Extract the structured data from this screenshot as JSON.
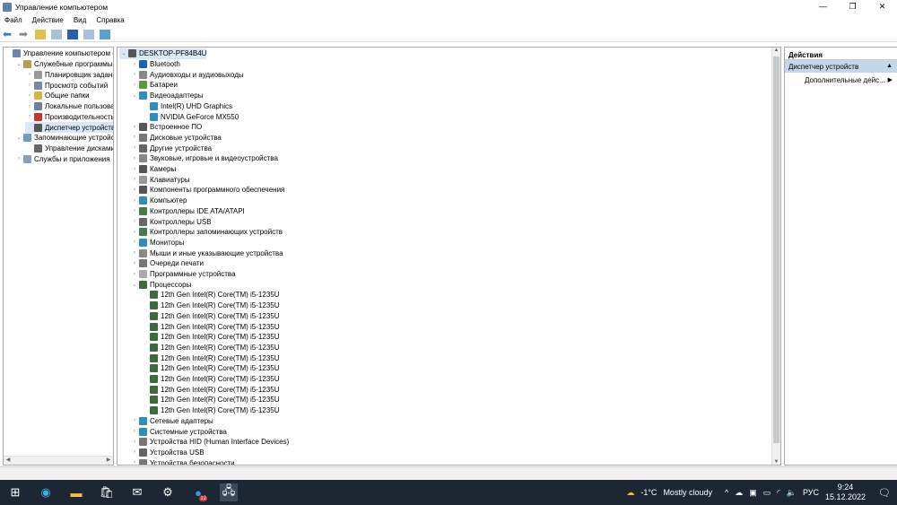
{
  "window": {
    "title": "Управление компьютером",
    "minimize": "—",
    "maximize": "❐",
    "close": "✕"
  },
  "menu": [
    "Файл",
    "Действие",
    "Вид",
    "Справка"
  ],
  "left_tree": [
    {
      "label": "Управление компьютером (лс",
      "level": 0,
      "arrow": "",
      "icon": "#6a86a8"
    },
    {
      "label": "Служебные программы",
      "level": 1,
      "arrow": "⌄",
      "icon": "#b89b54"
    },
    {
      "label": "Планировщик заданий",
      "level": 2,
      "arrow": "›",
      "icon": "#999"
    },
    {
      "label": "Просмотр событий",
      "level": 2,
      "arrow": "›",
      "icon": "#7a8898"
    },
    {
      "label": "Общие папки",
      "level": 2,
      "arrow": "›",
      "icon": "#d9b340"
    },
    {
      "label": "Локальные пользовате",
      "level": 2,
      "arrow": "›",
      "icon": "#6d7f99"
    },
    {
      "label": "Производительность",
      "level": 2,
      "arrow": "›",
      "icon": "#c0392b"
    },
    {
      "label": "Диспетчер устройств",
      "level": 2,
      "arrow": "",
      "icon": "#555",
      "selected": true
    },
    {
      "label": "Запоминающие устройств",
      "level": 1,
      "arrow": "⌄",
      "icon": "#6c9dc8"
    },
    {
      "label": "Управление дисками",
      "level": 2,
      "arrow": "",
      "icon": "#666"
    },
    {
      "label": "Службы и приложения",
      "level": 1,
      "arrow": "›",
      "icon": "#8aa0b8"
    }
  ],
  "device_tree": [
    {
      "label": "DESKTOP-PF84B4U",
      "level": 0,
      "arrow": "⌄",
      "icon": "#555",
      "selected": true
    },
    {
      "label": "Bluetooth",
      "level": 1,
      "arrow": "›",
      "icon": "#1565c0"
    },
    {
      "label": "Аудиовходы и аудиовыходы",
      "level": 1,
      "arrow": "›",
      "icon": "#888"
    },
    {
      "label": "Батареи",
      "level": 1,
      "arrow": "›",
      "icon": "#5a9a3a"
    },
    {
      "label": "Видеоадаптеры",
      "level": 1,
      "arrow": "⌄",
      "icon": "#2e8fbf"
    },
    {
      "label": "Intel(R) UHD Graphics",
      "level": 2,
      "arrow": "",
      "icon": "#2e8fbf"
    },
    {
      "label": "NVIDIA GeForce MX550",
      "level": 2,
      "arrow": "",
      "icon": "#2e8fbf"
    },
    {
      "label": "Встроенное ПО",
      "level": 1,
      "arrow": "›",
      "icon": "#555"
    },
    {
      "label": "Дисковые устройства",
      "level": 1,
      "arrow": "›",
      "icon": "#777"
    },
    {
      "label": "Другие устройства",
      "level": 1,
      "arrow": "›",
      "icon": "#666"
    },
    {
      "label": "Звуковые, игровые и видеоустройства",
      "level": 1,
      "arrow": "›",
      "icon": "#888"
    },
    {
      "label": "Камеры",
      "level": 1,
      "arrow": "›",
      "icon": "#555"
    },
    {
      "label": "Клавиатуры",
      "level": 1,
      "arrow": "›",
      "icon": "#999"
    },
    {
      "label": "Компоненты программного обеспечения",
      "level": 1,
      "arrow": "›",
      "icon": "#555"
    },
    {
      "label": "Компьютер",
      "level": 1,
      "arrow": "›",
      "icon": "#2e8fbf"
    },
    {
      "label": "Контроллеры IDE ATA/ATAPI",
      "level": 1,
      "arrow": "›",
      "icon": "#4a7a4a"
    },
    {
      "label": "Контроллеры USB",
      "level": 1,
      "arrow": "›",
      "icon": "#666"
    },
    {
      "label": "Контроллеры запоминающих устройств",
      "level": 1,
      "arrow": "›",
      "icon": "#4a7a4a"
    },
    {
      "label": "Мониторы",
      "level": 1,
      "arrow": "›",
      "icon": "#2e8fbf"
    },
    {
      "label": "Мыши и иные указывающие устройства",
      "level": 1,
      "arrow": "›",
      "icon": "#888"
    },
    {
      "label": "Очереди печати",
      "level": 1,
      "arrow": "›",
      "icon": "#777"
    },
    {
      "label": "Программные устройства",
      "level": 1,
      "arrow": "›",
      "icon": "#aaa"
    },
    {
      "label": "Процессоры",
      "level": 1,
      "arrow": "⌄",
      "icon": "#3d6b3d"
    },
    {
      "label": "12th Gen Intel(R) Core(TM) i5-1235U",
      "level": 2,
      "arrow": "",
      "icon": "#3d6b3d"
    },
    {
      "label": "12th Gen Intel(R) Core(TM) i5-1235U",
      "level": 2,
      "arrow": "",
      "icon": "#3d6b3d"
    },
    {
      "label": "12th Gen Intel(R) Core(TM) i5-1235U",
      "level": 2,
      "arrow": "",
      "icon": "#3d6b3d"
    },
    {
      "label": "12th Gen Intel(R) Core(TM) i5-1235U",
      "level": 2,
      "arrow": "",
      "icon": "#3d6b3d"
    },
    {
      "label": "12th Gen Intel(R) Core(TM) i5-1235U",
      "level": 2,
      "arrow": "",
      "icon": "#3d6b3d"
    },
    {
      "label": "12th Gen Intel(R) Core(TM) i5-1235U",
      "level": 2,
      "arrow": "",
      "icon": "#3d6b3d"
    },
    {
      "label": "12th Gen Intel(R) Core(TM) i5-1235U",
      "level": 2,
      "arrow": "",
      "icon": "#3d6b3d"
    },
    {
      "label": "12th Gen Intel(R) Core(TM) i5-1235U",
      "level": 2,
      "arrow": "",
      "icon": "#3d6b3d"
    },
    {
      "label": "12th Gen Intel(R) Core(TM) i5-1235U",
      "level": 2,
      "arrow": "",
      "icon": "#3d6b3d"
    },
    {
      "label": "12th Gen Intel(R) Core(TM) i5-1235U",
      "level": 2,
      "arrow": "",
      "icon": "#3d6b3d"
    },
    {
      "label": "12th Gen Intel(R) Core(TM) i5-1235U",
      "level": 2,
      "arrow": "",
      "icon": "#3d6b3d"
    },
    {
      "label": "12th Gen Intel(R) Core(TM) i5-1235U",
      "level": 2,
      "arrow": "",
      "icon": "#3d6b3d"
    },
    {
      "label": "Сетевые адаптеры",
      "level": 1,
      "arrow": "›",
      "icon": "#2e8fbf"
    },
    {
      "label": "Системные устройства",
      "level": 1,
      "arrow": "›",
      "icon": "#2e8fbf"
    },
    {
      "label": "Устройства HID (Human Interface Devices)",
      "level": 1,
      "arrow": "›",
      "icon": "#777"
    },
    {
      "label": "Устройства USB",
      "level": 1,
      "arrow": "›",
      "icon": "#666"
    },
    {
      "label": "Устройства безопасности",
      "level": 1,
      "arrow": "›",
      "icon": "#777"
    }
  ],
  "actions": {
    "header": "Действия",
    "section": "Диспетчер устройств",
    "item": "Дополнительные дейс..."
  },
  "taskbar": {
    "weather_temp": "-1°C",
    "weather_text": "Mostly cloudy",
    "lang": "РУС",
    "time": "9:24",
    "date": "15.12.2022",
    "badge": "12"
  }
}
